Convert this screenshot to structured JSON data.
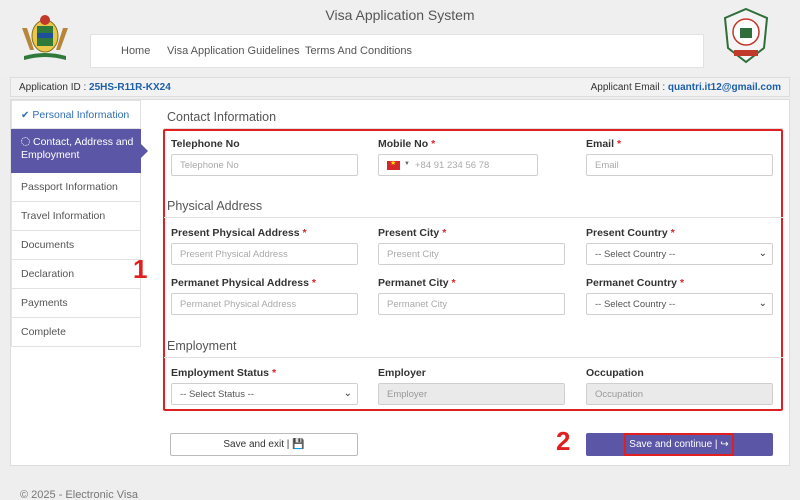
{
  "app": {
    "title": "Visa Application System"
  },
  "nav": [
    {
      "label": "Home"
    },
    {
      "label": "Visa Application Guidelines"
    },
    {
      "label": "Terms And Conditions"
    }
  ],
  "infobar": {
    "app_id_label": "Application ID :",
    "app_id_value": "25HS-R11R-KX24",
    "email_label": "Applicant Email :",
    "email_value": "quantri.it12@gmail.com"
  },
  "sidebar": [
    {
      "label": "Personal Information",
      "state": "completed",
      "icon": "check-icon"
    },
    {
      "label": "Contact, Address and Employment",
      "state": "active",
      "icon": "spinner-icon"
    },
    {
      "label": "Passport Information"
    },
    {
      "label": "Travel Information"
    },
    {
      "label": "Documents"
    },
    {
      "label": "Declaration"
    },
    {
      "label": "Payments"
    },
    {
      "label": "Complete"
    }
  ],
  "sections": {
    "contact": "Contact Information",
    "address": "Physical Address",
    "employment": "Employment"
  },
  "fields": {
    "telephone": {
      "label": "Telephone No",
      "placeholder": "Telephone No"
    },
    "mobile": {
      "label": "Mobile No",
      "placeholder": "+84 91 234 56 78"
    },
    "email": {
      "label": "Email",
      "placeholder": "Email"
    },
    "present_address": {
      "label": "Present Physical Address",
      "placeholder": "Present Physical Address"
    },
    "present_city": {
      "label": "Present City",
      "placeholder": "Present City"
    },
    "present_country": {
      "label": "Present Country",
      "value": "-- Select Country --"
    },
    "perm_address": {
      "label": "Permanet Physical Address",
      "placeholder": "Permanet Physical Address"
    },
    "perm_city": {
      "label": "Permanet City",
      "placeholder": "Permanet City"
    },
    "perm_country": {
      "label": "Permanet Country",
      "value": "-- Select Country --"
    },
    "emp_status": {
      "label": "Employment Status",
      "value": "-- Select Status --"
    },
    "employer": {
      "label": "Employer",
      "placeholder": "Employer"
    },
    "occupation": {
      "label": "Occupation",
      "placeholder": "Occupation"
    }
  },
  "required_marker": "*",
  "callouts": {
    "one": "1",
    "two": "2"
  },
  "buttons": {
    "save_exit": "Save and exit |",
    "save_continue": "Save and continue |"
  },
  "icons": {
    "save": "floppy-disk-icon",
    "forward": "share-forward-icon",
    "dropdown": "chevron-down-icon"
  },
  "colors": {
    "accent": "#5b57a6",
    "highlight_box": "#e02020",
    "link": "#1d5fa8",
    "required": "#d9262b"
  },
  "footer": "© 2025 - Electronic Visa"
}
